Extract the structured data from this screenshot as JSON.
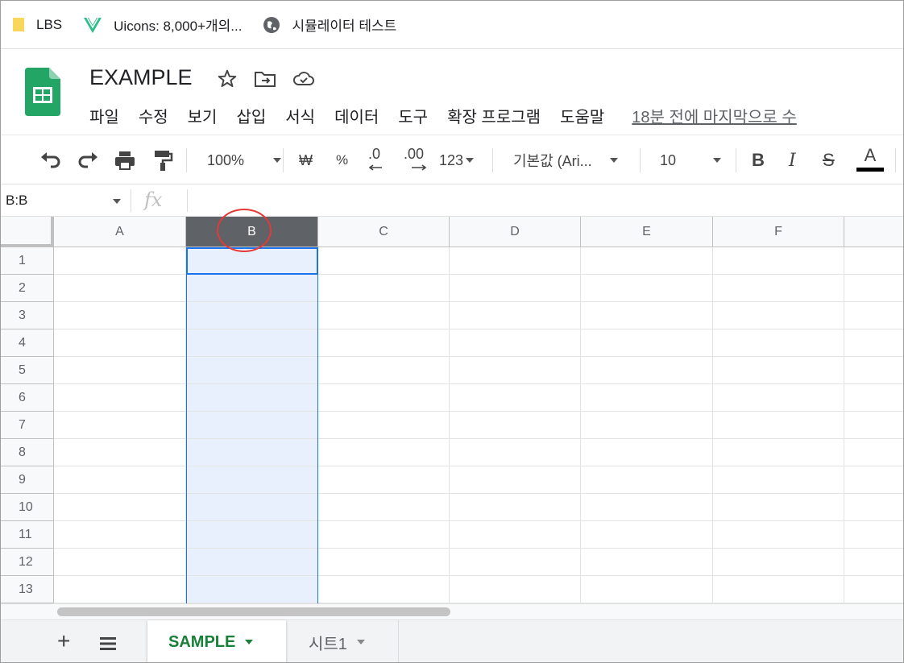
{
  "bookmarks": [
    {
      "label": "LBS",
      "icon": "folder-icon"
    },
    {
      "label": "Uicons: 8,000+개의...",
      "icon": "uicons-icon"
    },
    {
      "label": "시뮬레이터 테스트",
      "icon": "globe-icon"
    }
  ],
  "doc": {
    "title": "EXAMPLE"
  },
  "menu": {
    "items": [
      "파일",
      "수정",
      "보기",
      "삽입",
      "서식",
      "데이터",
      "도구",
      "확장 프로그램",
      "도움말"
    ],
    "last_edit": "18분 전에 마지막으로 수"
  },
  "toolbar": {
    "zoom": "100%",
    "currency": "₩",
    "percent": "%",
    "dec_decrease": ".0",
    "dec_increase": ".00",
    "number_format": "123",
    "font": "기본값 (Ari...",
    "font_size": "10",
    "bold": "B",
    "italic": "I",
    "strike": "S",
    "text_color": "A"
  },
  "formula_bar": {
    "name_box": "B:B",
    "fx": "fx"
  },
  "grid": {
    "columns": [
      "A",
      "B",
      "C",
      "D",
      "E",
      "F"
    ],
    "rows": [
      "1",
      "2",
      "3",
      "4",
      "5",
      "6",
      "7",
      "8",
      "9",
      "10",
      "11",
      "12",
      "13"
    ],
    "selected_column": "B"
  },
  "sheets": {
    "add_label": "+",
    "tabs": [
      {
        "label": "SAMPLE",
        "active": true
      },
      {
        "label": "시트1",
        "active": false
      }
    ]
  },
  "colors": {
    "selection": "#1a73e8",
    "active_tab": "#188038",
    "annotation": "#e53935"
  }
}
